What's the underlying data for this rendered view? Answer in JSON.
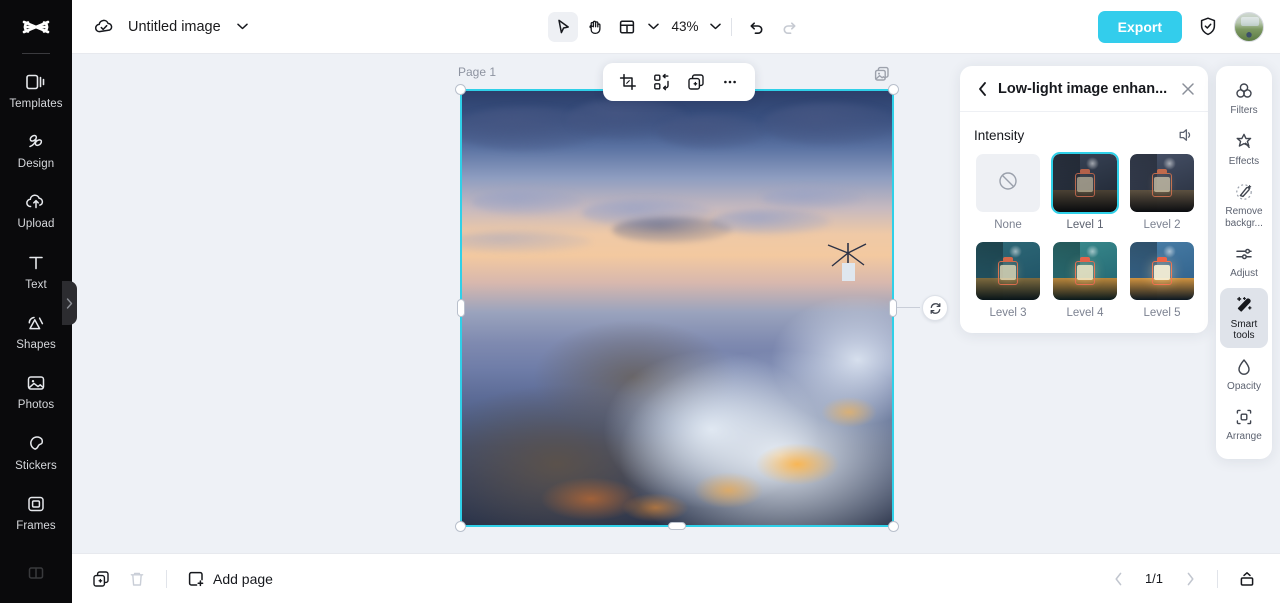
{
  "app": {
    "logo": "capcut-logo",
    "accent": "#33cdec",
    "selection_color": "#2fd0e8"
  },
  "sidebar": {
    "items": [
      {
        "label": "Templates",
        "icon": "templates-icon"
      },
      {
        "label": "Design",
        "icon": "design-icon"
      },
      {
        "label": "Upload",
        "icon": "upload-cloud-icon"
      },
      {
        "label": "Text",
        "icon": "text-icon"
      },
      {
        "label": "Shapes",
        "icon": "shapes-icon"
      },
      {
        "label": "Photos",
        "icon": "photos-icon"
      },
      {
        "label": "Stickers",
        "icon": "stickers-icon"
      },
      {
        "label": "Frames",
        "icon": "frames-icon"
      }
    ],
    "collapse_icon": "chevron-right-icon"
  },
  "topbar": {
    "cloud_icon": "cloud-saved-icon",
    "title": "Untitled image",
    "title_caret": "chevron-down-icon",
    "tools": [
      {
        "name": "select-tool",
        "icon": "cursor-arrow-icon",
        "active": true
      },
      {
        "name": "hand-tool",
        "icon": "hand-icon",
        "active": false
      },
      {
        "name": "layout-tool",
        "icon": "layout-icon",
        "active": false
      }
    ],
    "layout_caret": "chevron-down-icon",
    "zoom_value": "43%",
    "zoom_caret": "chevron-down-icon",
    "undo_icon": "undo-icon",
    "redo_icon": "redo-icon",
    "export_label": "Export",
    "shield_icon": "shield-check-icon",
    "avatar": "user-avatar"
  },
  "canvas": {
    "page_label": "Page 1",
    "duplicate_page_icon": "duplicate-page-icon",
    "rotate_icon": "rotate-icon",
    "object_toolbar": [
      {
        "name": "crop-button",
        "icon": "crop-icon"
      },
      {
        "name": "split-button",
        "icon": "split-objects-icon"
      },
      {
        "name": "duplicate-button",
        "icon": "duplicate-icon"
      },
      {
        "name": "more-options-button",
        "icon": "more-horizontal-icon"
      }
    ]
  },
  "panel": {
    "back_icon": "chevron-left-icon",
    "title": "Low-light image enhan...",
    "close_icon": "close-icon",
    "section_label": "Intensity",
    "compare_icon": "compare-icon",
    "options": [
      {
        "label": "None",
        "icon": "no-effect-icon",
        "selected": false,
        "kind": "none"
      },
      {
        "label": "Level 1",
        "selected": true,
        "kind": "lantern",
        "bg1": "#3a4558",
        "bg2": "#1d2430",
        "rock": "#4a4134",
        "glass": "#cfc3a6",
        "frame": "#b3614a",
        "glow": 0.25
      },
      {
        "label": "Level 2",
        "selected": false,
        "kind": "lantern",
        "bg1": "#48536a",
        "bg2": "#262d3b",
        "rock": "#5c5040",
        "glass": "#ded2b4",
        "frame": "#c06a4c",
        "glow": 0.35
      },
      {
        "label": "Level 3",
        "selected": false,
        "kind": "lantern",
        "bg1": "#2f6a78",
        "bg2": "#1d4f63",
        "rock": "#7d6a3e",
        "glass": "#ece0bd",
        "frame": "#d4684a",
        "glow": 0.5
      },
      {
        "label": "Level 4",
        "selected": false,
        "kind": "lantern",
        "bg1": "#3a8c8e",
        "bg2": "#20616e",
        "rock": "#b9863c",
        "glass": "#f4eac7",
        "frame": "#e4634a",
        "glow": 0.7
      },
      {
        "label": "Level 5",
        "selected": false,
        "kind": "lantern",
        "bg1": "#4a7fa8",
        "bg2": "#2c5c86",
        "rock": "#cf9240",
        "glass": "#f8f0d6",
        "frame": "#ef6446",
        "glow": 0.85
      }
    ]
  },
  "tool_rail": {
    "items": [
      {
        "label": "Filters",
        "icon": "filters-icon",
        "active": false
      },
      {
        "label": "Effects",
        "icon": "effects-icon",
        "active": false
      },
      {
        "label": "Remove\nbackgr...",
        "icon": "remove-bg-icon",
        "active": false
      },
      {
        "label": "Adjust",
        "icon": "adjust-icon",
        "active": false
      },
      {
        "label": "Smart\ntools",
        "icon": "smart-tools-icon",
        "active": true
      },
      {
        "label": "Opacity",
        "icon": "opacity-icon",
        "active": false
      },
      {
        "label": "Arrange",
        "icon": "arrange-icon",
        "active": false
      }
    ]
  },
  "bottombar": {
    "duplicate_page_icon": "duplicate-page-icon",
    "delete_page_icon": "trash-icon",
    "add_page_label": "Add page",
    "add_page_icon": "add-page-icon",
    "prev_icon": "chevron-left-icon",
    "page_indicator": "1/1",
    "next_icon": "chevron-right-icon",
    "pages_panel_icon": "pages-panel-icon"
  }
}
